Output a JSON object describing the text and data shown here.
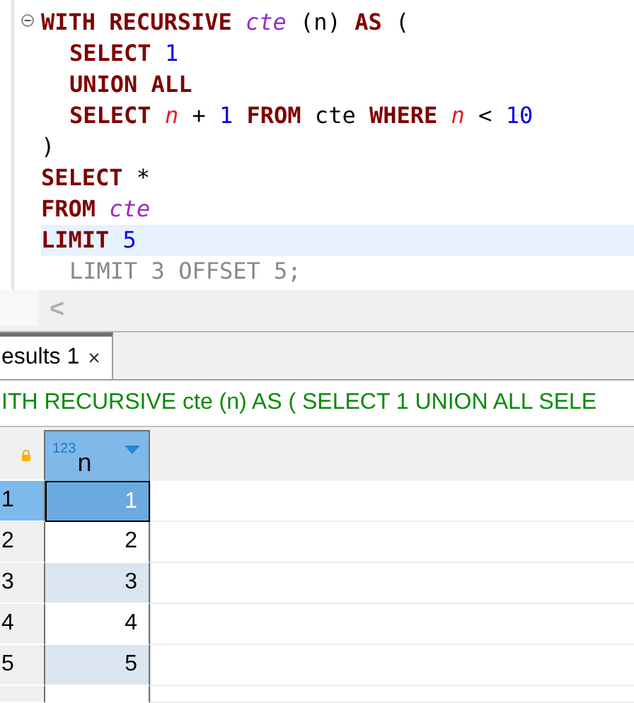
{
  "editor": {
    "lines": [
      {
        "current": false,
        "foldable": true,
        "tokens": [
          {
            "kind": "keyword",
            "text": "WITH RECURSIVE "
          },
          {
            "kind": "table",
            "text": "cte"
          },
          {
            "kind": "plain",
            "text": " (n) "
          },
          {
            "kind": "keyword",
            "text": "AS"
          },
          {
            "kind": "plain",
            "text": " ("
          }
        ]
      },
      {
        "current": false,
        "foldable": false,
        "indented": true,
        "tokens": [
          {
            "kind": "keyword",
            "text": "SELECT "
          },
          {
            "kind": "number",
            "text": "1"
          }
        ]
      },
      {
        "current": false,
        "foldable": false,
        "indented": true,
        "tokens": [
          {
            "kind": "keyword",
            "text": "UNION ALL"
          }
        ]
      },
      {
        "current": false,
        "foldable": false,
        "indented": true,
        "tokens": [
          {
            "kind": "keyword",
            "text": "SELECT "
          },
          {
            "kind": "column",
            "text": "n"
          },
          {
            "kind": "plain",
            "text": " + "
          },
          {
            "kind": "number",
            "text": "1"
          },
          {
            "kind": "keyword",
            "text": " FROM"
          },
          {
            "kind": "plain",
            "text": " cte "
          },
          {
            "kind": "keyword",
            "text": "WHERE "
          },
          {
            "kind": "column",
            "text": "n"
          },
          {
            "kind": "plain",
            "text": " < "
          },
          {
            "kind": "number",
            "text": "10"
          }
        ]
      },
      {
        "current": false,
        "foldable": false,
        "tokens": [
          {
            "kind": "plain",
            "text": ")"
          }
        ]
      },
      {
        "current": false,
        "foldable": false,
        "tokens": [
          {
            "kind": "keyword",
            "text": "SELECT"
          },
          {
            "kind": "plain",
            "text": " *"
          }
        ]
      },
      {
        "current": false,
        "foldable": false,
        "tokens": [
          {
            "kind": "keyword",
            "text": "FROM "
          },
          {
            "kind": "table",
            "text": "cte"
          }
        ]
      },
      {
        "current": true,
        "foldable": false,
        "tokens": [
          {
            "kind": "keyword",
            "text": "LIMIT "
          },
          {
            "kind": "number",
            "text": "5"
          }
        ]
      },
      {
        "current": false,
        "foldable": false,
        "indented": true,
        "tokens": [
          {
            "kind": "plain",
            "text": "LIMIT 3 OFFSET 5;"
          }
        ]
      }
    ],
    "scroll_left": "<"
  },
  "results": {
    "tab": {
      "label": "esults 1",
      "close": "×",
      "selected": true
    },
    "query_text": "ITH RECURSIVE cte (n) AS ( SELECT 1 UNION ALL SELE",
    "columns": [
      {
        "label": "n",
        "type_badge": "123"
      }
    ],
    "rows": [
      {
        "number": "1",
        "value": "1",
        "selected": true
      },
      {
        "number": "2",
        "value": "2",
        "selected": false
      },
      {
        "number": "3",
        "value": "3",
        "selected": false
      },
      {
        "number": "4",
        "value": "4",
        "selected": false
      },
      {
        "number": "5",
        "value": "5",
        "selected": false
      }
    ]
  }
}
